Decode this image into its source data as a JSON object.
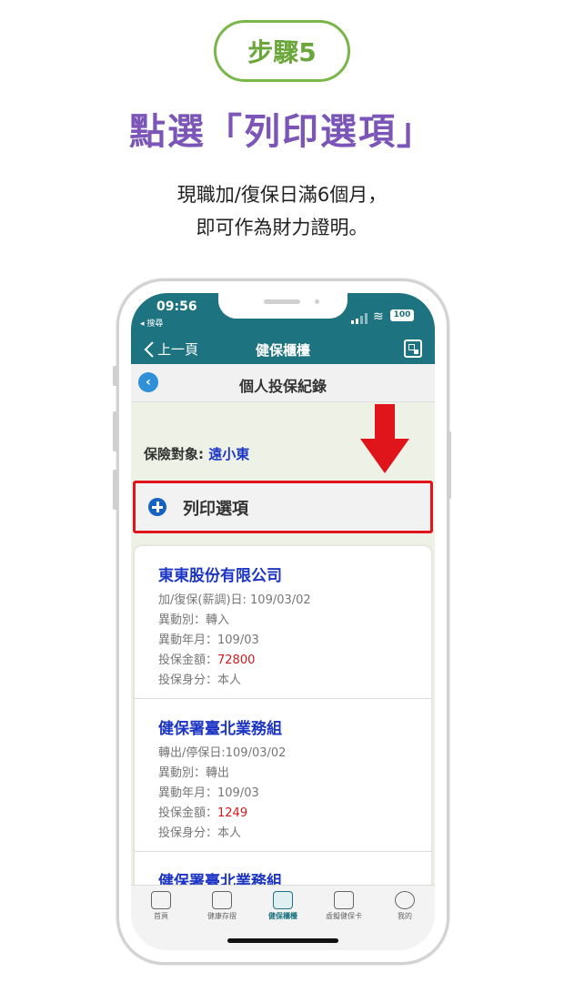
{
  "step": {
    "label": "步驟5"
  },
  "headline": "點選「列印選項」",
  "description": {
    "line1": "現職加/復保日滿6個月，",
    "line2": "即可作為財力證明。"
  },
  "phone": {
    "status": {
      "time": "09:56",
      "back_app": "◂ 搜尋",
      "battery": "100"
    },
    "nav": {
      "back_label": "上一頁",
      "title": "健保櫃檯"
    },
    "subheader": {
      "title": "個人投保紀錄"
    },
    "target": {
      "label": "保險對象:",
      "name": "遠小東"
    },
    "print_options": {
      "label": "列印選項"
    },
    "records": [
      {
        "company": "東東股份有限公司",
        "date_line": "加/復保(薪調)日: 109/03/02",
        "type_line": "異動別：轉入",
        "ym_line": "異動年月：109/03",
        "amount_label": "投保金額：",
        "amount": "72800",
        "identity_line": "投保身分：本人"
      },
      {
        "company": "健保署臺北業務組",
        "date_line": "轉出/停保日:109/03/02",
        "type_line": "異動別：轉出",
        "ym_line": "異動年月：109/03",
        "amount_label": "投保金額：",
        "amount": "1249",
        "identity_line": "投保身分：本人"
      },
      {
        "company": "健保署臺北業務組"
      }
    ],
    "tabs": [
      {
        "label": "首頁",
        "icon": "home-icon"
      },
      {
        "label": "健康存摺",
        "icon": "health-passbook-icon"
      },
      {
        "label": "健保櫃檯",
        "icon": "counter-icon",
        "active": true
      },
      {
        "label": "虛擬健保卡",
        "icon": "virtual-card-icon"
      },
      {
        "label": "我的",
        "icon": "profile-icon"
      }
    ]
  },
  "colors": {
    "accent_green": "#7ab648",
    "headline_purple": "#7b55b7",
    "teal": "#1e7380",
    "highlight_red": "#e0141b",
    "link_blue": "#1c35c5"
  }
}
